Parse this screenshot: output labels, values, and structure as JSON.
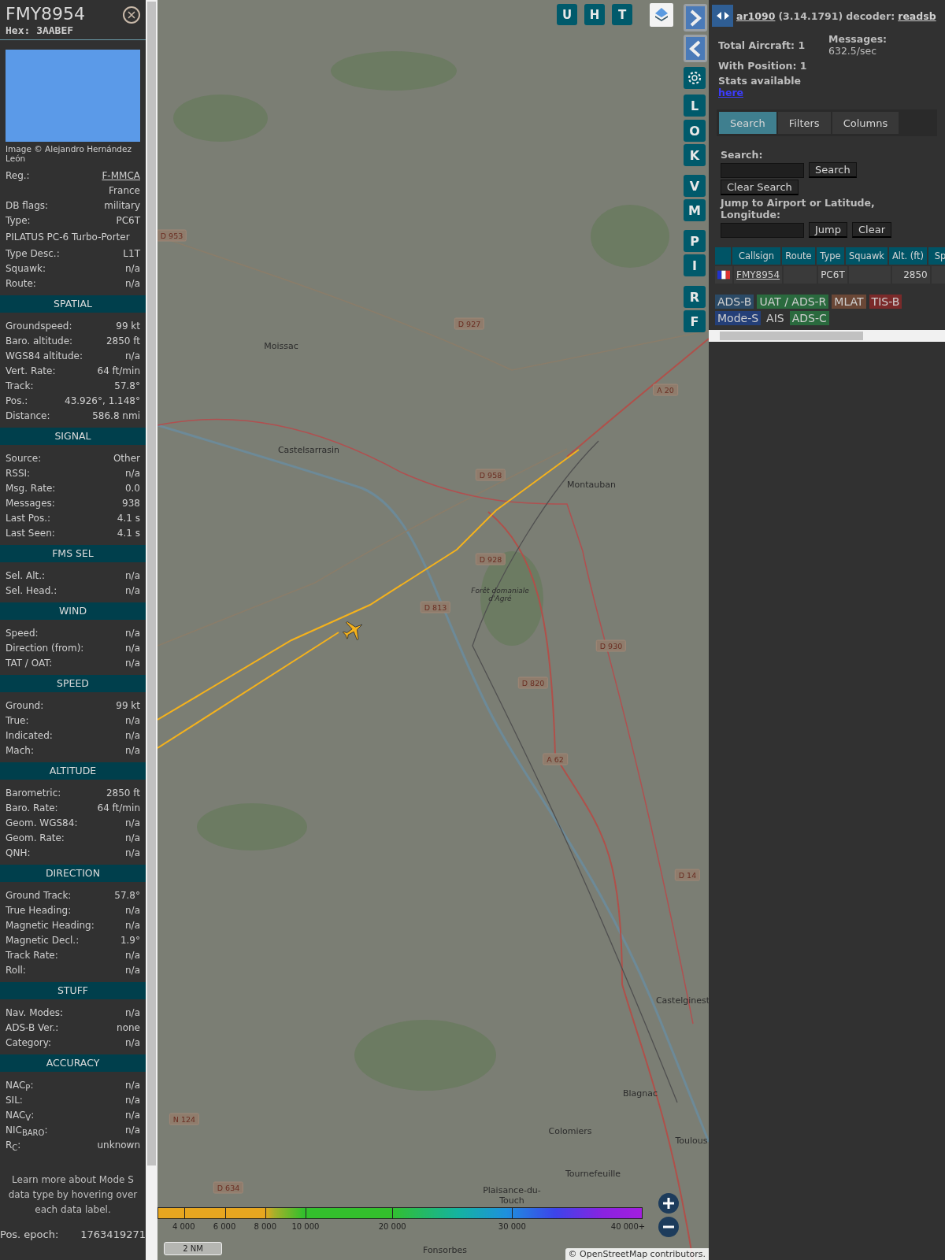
{
  "detail": {
    "callsign": "FMY8954",
    "hex": "Hex: 3AABEF",
    "photo_caption": "Image © Alejandro Hernández León",
    "sections": [
      {
        "rows": [
          {
            "kind": "link",
            "label": "Reg.:",
            "value": "F-MMCA"
          },
          {
            "kind": "value",
            "value": "France"
          },
          {
            "kind": "pair",
            "label": "DB flags:",
            "value": "military"
          },
          {
            "kind": "pair",
            "label": "Type:",
            "value": "PC6T"
          },
          {
            "kind": "text",
            "value": "PILATUS PC-6 Turbo-Porter"
          },
          {
            "kind": "pair",
            "label": "Type Desc.:",
            "value": "L1T"
          },
          {
            "kind": "pair",
            "label": "Squawk:",
            "value": "n/a"
          },
          {
            "kind": "pair",
            "label": "Route:",
            "value": "n/a"
          }
        ]
      },
      {
        "title": "SPATIAL",
        "rows": [
          {
            "kind": "pair",
            "label": "Groundspeed:",
            "value": "99 kt"
          },
          {
            "kind": "pair",
            "label": "Baro. altitude:",
            "value": "2850 ft"
          },
          {
            "kind": "pair",
            "label": "WGS84 altitude:",
            "value": "n/a"
          },
          {
            "kind": "pair",
            "label": "Vert. Rate:",
            "value": "64 ft/min"
          },
          {
            "kind": "pair",
            "label": "Track:",
            "value": "57.8°"
          },
          {
            "kind": "pair",
            "label": "Pos.:",
            "value": "43.926°, 1.148°"
          },
          {
            "kind": "pair",
            "label": "Distance:",
            "value": "586.8 nmi"
          }
        ]
      },
      {
        "title": "SIGNAL",
        "rows": [
          {
            "kind": "pair",
            "label": "Source:",
            "value": "Other"
          },
          {
            "kind": "pair",
            "label": "RSSI:",
            "value": "n/a"
          },
          {
            "kind": "pair",
            "label": "Msg. Rate:",
            "value": "0.0"
          },
          {
            "kind": "pair",
            "label": "Messages:",
            "value": "938"
          },
          {
            "kind": "pair",
            "label": "Last Pos.:",
            "value": "4.1 s"
          },
          {
            "kind": "pair",
            "label": "Last Seen:",
            "value": "4.1 s"
          }
        ]
      },
      {
        "title": "FMS SEL",
        "rows": [
          {
            "kind": "pair",
            "label": "Sel. Alt.:",
            "value": "n/a"
          },
          {
            "kind": "pair",
            "label": "Sel. Head.:",
            "value": "n/a"
          }
        ]
      },
      {
        "title": "WIND",
        "rows": [
          {
            "kind": "pair",
            "label": "Speed:",
            "value": "n/a"
          },
          {
            "kind": "pair",
            "label": "Direction (from):",
            "value": "n/a"
          },
          {
            "kind": "pair",
            "label": "TAT / OAT:",
            "value": "n/a"
          }
        ]
      },
      {
        "title": "SPEED",
        "rows": [
          {
            "kind": "pair",
            "label": "Ground:",
            "value": "99 kt"
          },
          {
            "kind": "pair",
            "label": "True:",
            "value": "n/a"
          },
          {
            "kind": "pair",
            "label": "Indicated:",
            "value": "n/a"
          },
          {
            "kind": "pair",
            "label": "Mach:",
            "value": "n/a"
          }
        ]
      },
      {
        "title": "ALTITUDE",
        "rows": [
          {
            "kind": "pair",
            "label": "Barometric:",
            "value": "2850 ft"
          },
          {
            "kind": "pair",
            "label": "Baro. Rate:",
            "value": "64 ft/min"
          },
          {
            "kind": "pair",
            "label": "Geom. WGS84:",
            "value": "n/a"
          },
          {
            "kind": "pair",
            "label": "Geom. Rate:",
            "value": "n/a"
          },
          {
            "kind": "pair",
            "label": "QNH:",
            "value": "n/a"
          }
        ]
      },
      {
        "title": "DIRECTION",
        "rows": [
          {
            "kind": "pair",
            "label": "Ground Track:",
            "value": "57.8°"
          },
          {
            "kind": "pair",
            "label": "True Heading:",
            "value": "n/a"
          },
          {
            "kind": "pair",
            "label": "Magnetic Heading:",
            "value": "n/a"
          },
          {
            "kind": "pair",
            "label": "Magnetic Decl.:",
            "value": "1.9°"
          },
          {
            "kind": "pair",
            "label": "Track Rate:",
            "value": "n/a"
          },
          {
            "kind": "pair",
            "label": "Roll:",
            "value": "n/a"
          }
        ]
      },
      {
        "title": "STUFF",
        "rows": [
          {
            "kind": "pair",
            "label": "Nav. Modes:",
            "value": "n/a"
          },
          {
            "kind": "pair",
            "label": "ADS-B Ver.:",
            "value": "none"
          },
          {
            "kind": "pair",
            "label": "Category:",
            "value": "n/a"
          }
        ]
      },
      {
        "title": "ACCURACY",
        "rows": [
          {
            "kind": "pair",
            "label": "NAC$_{P}$:",
            "value": "n/a"
          },
          {
            "kind": "pair",
            "label": "SIL:",
            "value": "n/a"
          },
          {
            "kind": "pair",
            "label": "NAC$_{V}$:",
            "value": "n/a"
          },
          {
            "kind": "pair",
            "label": "NIC$_{BARO}$:",
            "value": "n/a"
          },
          {
            "kind": "pair",
            "label": "R$_{C}$:",
            "value": "unknown"
          }
        ]
      }
    ],
    "note": "Learn more about Mode S data type by hovering over each data label.",
    "epoch": {
      "label": "Pos. epoch:",
      "value": "1763419271"
    }
  },
  "map": {
    "top_buttons": [
      "U",
      "H",
      "T"
    ],
    "side_buttons": [
      {
        "kind": "arrow-right"
      },
      {
        "kind": "arrow-left"
      },
      {
        "kind": "gear"
      },
      {
        "kind": "letter",
        "label": "L"
      },
      {
        "kind": "letter",
        "label": "O"
      },
      {
        "kind": "letter",
        "label": "K"
      },
      {
        "kind": "letter",
        "label": "V"
      },
      {
        "kind": "letter",
        "label": "M"
      },
      {
        "kind": "letter",
        "label": "P"
      },
      {
        "kind": "letter",
        "label": "I"
      },
      {
        "kind": "letter",
        "label": "R"
      },
      {
        "kind": "letter",
        "label": "F"
      }
    ],
    "places": [
      "Moissac",
      "Castelsarrasin",
      "Montauban",
      "Forêt domaniale d'Agré",
      "Castelginest",
      "Blagnac",
      "Colomiers",
      "Toulous",
      "Tournefeuille",
      "Plaisance-du-Touch",
      "Fonsorbes"
    ],
    "roads": [
      "D 953",
      "D 927",
      "A 20",
      "D 958",
      "D 928",
      "D 813",
      "D 930",
      "D 820",
      "A 62",
      "D 14",
      "N 124",
      "D 634"
    ],
    "altitude_labels": [
      "4 000",
      "6 000",
      "8 000",
      "10 000",
      "20 000",
      "30 000",
      "40 000+"
    ],
    "scale": "2 NM",
    "attribution": "© OpenStreetMap contributors."
  },
  "panel": {
    "header": {
      "link": "ar1090",
      "version": "(3.14.1791)",
      "decoder_label": "decoder:",
      "decoder": "readsb"
    },
    "stats": {
      "total": "Total Aircraft: 1",
      "messages_label": "Messages:",
      "messages": "632.5/sec",
      "position": "With Position: 1",
      "stats": "Stats available",
      "stats_link": "here"
    },
    "tabs": [
      {
        "label": "Search",
        "selected": true
      },
      {
        "label": "Filters",
        "selected": false
      },
      {
        "label": "Columns",
        "selected": false
      }
    ],
    "search": {
      "label": "Search:",
      "button": "Search",
      "clear": "Clear Search",
      "jump_label": "Jump to Airport or Latitude, Longitude:",
      "jump": "Jump",
      "jump_clear": "Clear"
    },
    "table": {
      "columns": [
        "",
        "Callsign",
        "Route",
        "Type",
        "Squawk",
        "Alt. (ft)",
        "Sp"
      ],
      "rows": [
        {
          "callsign": "FMY8954",
          "route": "",
          "type": "PC6T",
          "squawk": "",
          "altitude": "2850"
        }
      ]
    },
    "legend": [
      {
        "label": "ADS-B",
        "color": "#2b4a66"
      },
      {
        "label": "UAT / ADS-R",
        "color": "#2a6a3e"
      },
      {
        "label": "MLAT",
        "color": "#6a4736"
      },
      {
        "label": "TIS-B",
        "color": "#7a2a2a"
      },
      {
        "label": "Mode-S",
        "color": "#243f78"
      },
      {
        "label": "AIS"
      },
      {
        "label": "ADS-C",
        "color": "#2a6a3e"
      }
    ]
  }
}
